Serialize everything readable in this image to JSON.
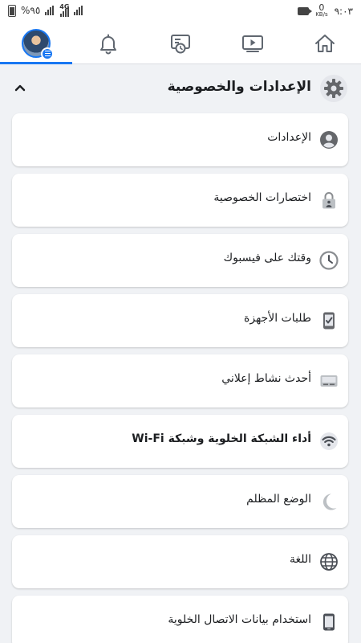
{
  "status_bar": {
    "battery": "%٩٥",
    "net_1": "4G",
    "speed_value": "0",
    "speed_unit": "KB/s",
    "time": "٩:٠٣"
  },
  "nav": {
    "tabs": [
      {
        "name": "home",
        "icon": "home-icon",
        "active": false
      },
      {
        "name": "watch",
        "icon": "video-icon",
        "active": false
      },
      {
        "name": "news",
        "icon": "news-clock-icon",
        "active": false
      },
      {
        "name": "notifications",
        "icon": "bell-icon",
        "active": false
      },
      {
        "name": "menu",
        "icon": "avatar",
        "active": true
      }
    ],
    "accent": "#1877f2"
  },
  "section": {
    "title": "الإعدادات والخصوصية",
    "icon": "gear-icon",
    "expanded": true
  },
  "items": [
    {
      "label": "الإعدادات",
      "icon": "user-circle-icon"
    },
    {
      "label": "اختصارات الخصوصية",
      "icon": "lock-icon"
    },
    {
      "label": "وقتك على فيسبوك",
      "icon": "clock-icon"
    },
    {
      "label": "طلبات الأجهزة",
      "icon": "device-check-icon"
    },
    {
      "label": "أحدث نشاط إعلاني",
      "icon": "ad-card-icon"
    },
    {
      "label": "أداء الشبكة الخلوية وشبكة Wi-Fi",
      "icon": "wifi-icon"
    },
    {
      "label": "الوضع المظلم",
      "icon": "moon-icon"
    },
    {
      "label": "اللغة",
      "icon": "globe-icon"
    },
    {
      "label": "استخدام بيانات الاتصال الخلوية",
      "icon": "phone-icon"
    }
  ]
}
